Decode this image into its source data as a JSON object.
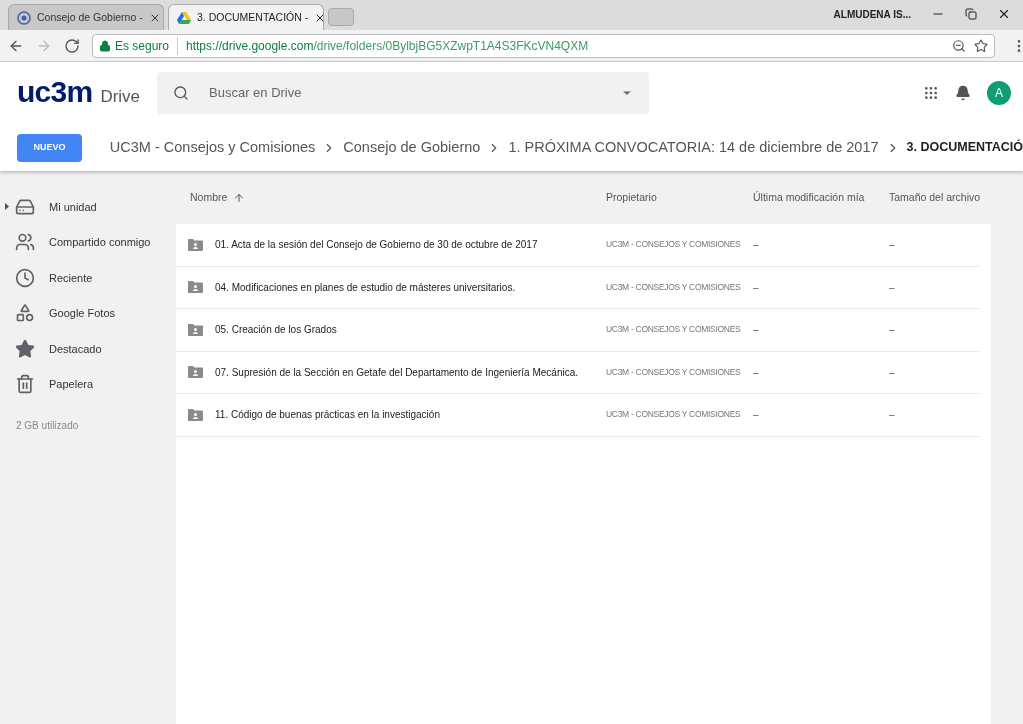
{
  "browser": {
    "tabs": [
      {
        "title": "Consejo de Gobierno -",
        "selected": false,
        "kind": "site"
      },
      {
        "title": "3. DOCUMENTACIÓN -",
        "selected": true,
        "kind": "drive"
      }
    ],
    "profile": "ALMUDENA IS...",
    "secure_label": "Es seguro",
    "url_host": "https://drive.google.com",
    "url_path": "/drive/folders/0BylbjBG5XZwpT1A4S3FKcVN4QXM"
  },
  "app": {
    "logo": "uc3m",
    "product": "Drive",
    "search": {
      "placeholder": "Buscar en Drive"
    },
    "avatar": "A"
  },
  "new_button": "NUEVO",
  "breadcrumb": [
    "UC3M - Consejos y Comisiones",
    "Consejo de Gobierno",
    "1. PRÓXIMA CONVOCATORIA: 14 de diciembre de 2017",
    "3. DOCUMENTACIÓ"
  ],
  "sidebar": {
    "items": [
      {
        "label": "Mi unidad",
        "kind": "drive"
      },
      {
        "label": "Compartido conmigo",
        "kind": "shared"
      },
      {
        "label": "Reciente",
        "kind": "recent"
      },
      {
        "label": "Google Fotos",
        "kind": "photos"
      },
      {
        "label": "Destacado",
        "kind": "starred"
      },
      {
        "label": "Papelera",
        "kind": "trash"
      }
    ],
    "storage": "2 GB utilizado"
  },
  "table": {
    "columns": [
      "Nombre",
      "Propietario",
      "Última modificación mía",
      "Tamaño del archivo"
    ],
    "rows": [
      {
        "name": "01. Acta de la sesión del Consejo de Gobierno de 30 de octubre de 2017",
        "owner": "UC3M - CONSEJOS Y COMISIONES",
        "modified": "–",
        "size": "–"
      },
      {
        "name": "04. Modificaciones en planes de estudio de másteres universitarios.",
        "owner": "UC3M - CONSEJOS Y COMISIONES",
        "modified": "–",
        "size": "–"
      },
      {
        "name": "05. Creación de los Grados",
        "owner": "UC3M - CONSEJOS Y COMISIONES",
        "modified": "–",
        "size": "–"
      },
      {
        "name": "07. Supresión de la Sección en Getafe del Departamento de Ingeniería Mecánica.",
        "owner": "UC3M - CONSEJOS Y COMISIONES",
        "modified": "–",
        "size": "–"
      },
      {
        "name": "11. Código de buenas prácticas en la investigación",
        "owner": "UC3M - CONSEJOS Y COMISIONES",
        "modified": "–",
        "size": "–"
      }
    ]
  }
}
